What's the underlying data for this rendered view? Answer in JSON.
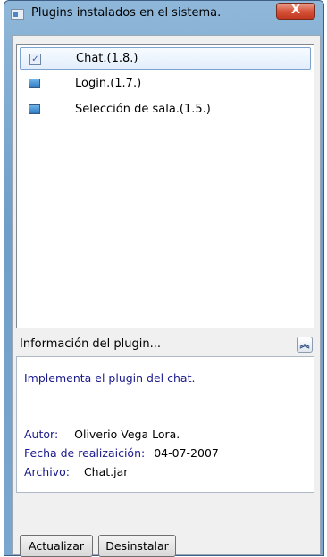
{
  "window": {
    "title": "Plugins instalados en el sistema.",
    "close_glyph": "X"
  },
  "plugins": [
    {
      "label": "Chat.(1.8.)",
      "selected": true,
      "icon": "checked-checkbox-icon"
    },
    {
      "label": "Login.(1.7.)",
      "selected": false,
      "icon": "plugin-icon"
    },
    {
      "label": "Selección de sala.(1.5.)",
      "selected": false,
      "icon": "plugin-icon"
    }
  ],
  "info": {
    "header": "Información del plugin...",
    "collapse_glyph": "«",
    "description": "Implementa el plugin del chat.",
    "author_label": "Autor:",
    "author_value": "Oliverio Vega Lora.",
    "date_label": "Fecha de realizaición:",
    "date_value": "04-07-2007",
    "file_label": "Archivo:",
    "file_value": "Chat.jar"
  },
  "buttons": {
    "update": "Actualizar",
    "uninstall": "Desinstalar"
  },
  "colors": {
    "label_text": "#1a1a8c",
    "selection_border": "#7da2ce",
    "close_button": "#d5543a"
  }
}
